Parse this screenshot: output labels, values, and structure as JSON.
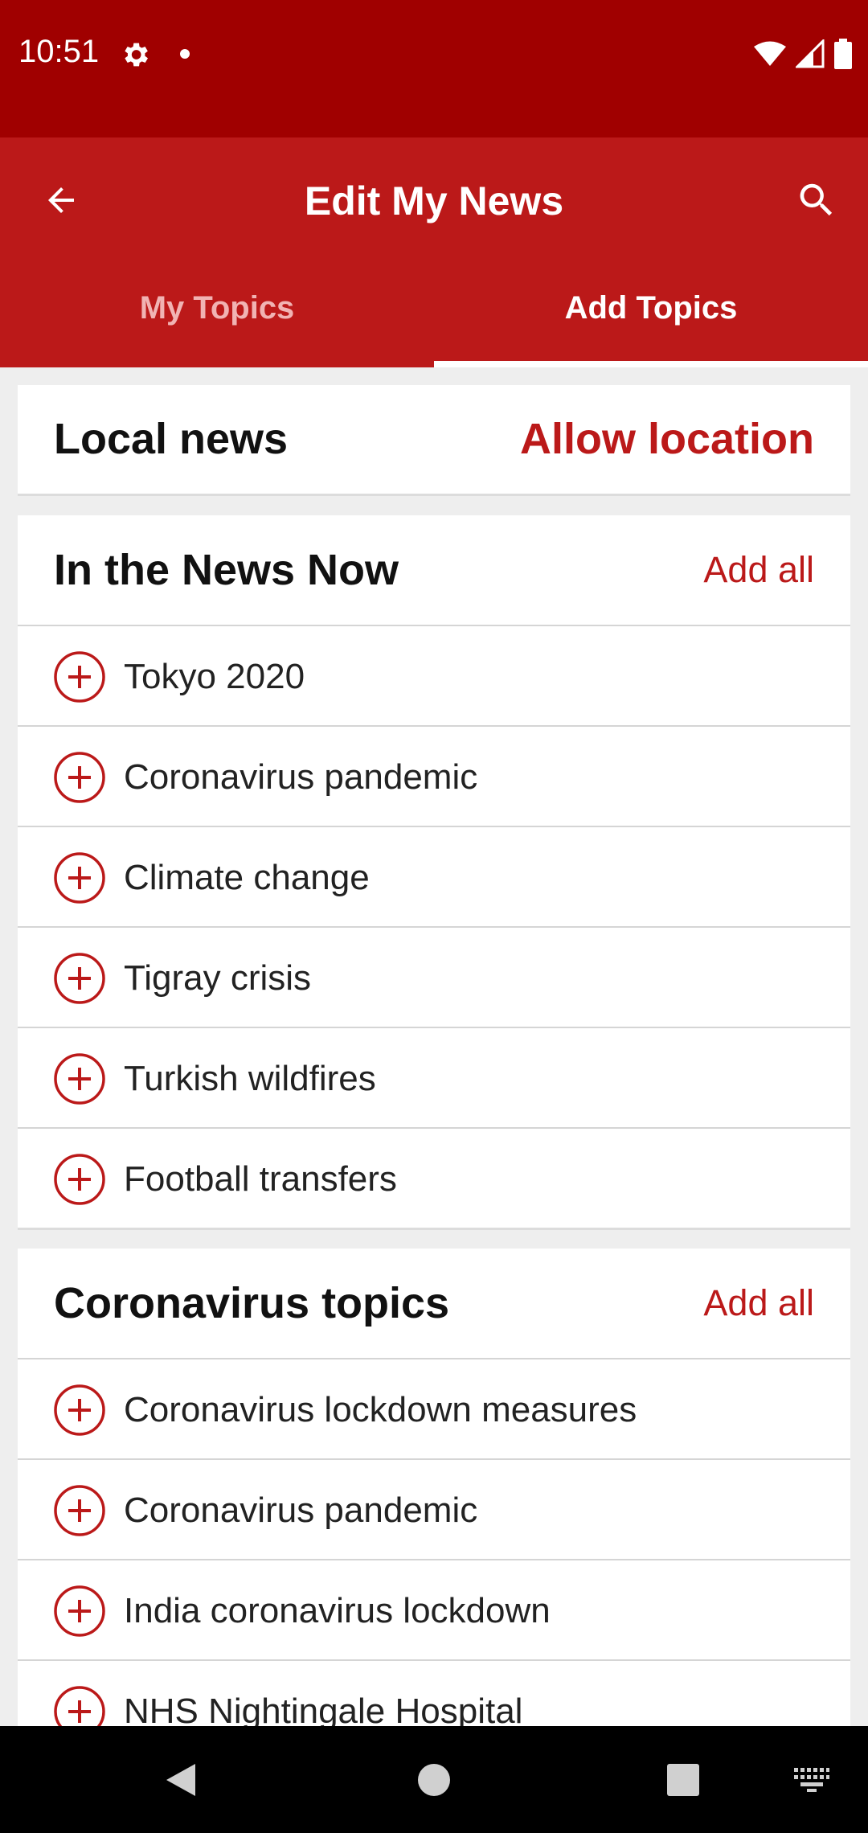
{
  "status_bar": {
    "time": "10:51",
    "icons": [
      "gear-icon",
      "notification-dot-icon",
      "wifi-icon",
      "signal-icon",
      "battery-icon"
    ]
  },
  "app_bar": {
    "title": "Edit My News",
    "back_icon": "arrow-left-icon",
    "search_icon": "search-icon",
    "tabs": [
      {
        "label": "My Topics",
        "selected": false
      },
      {
        "label": "Add Topics",
        "selected": true
      }
    ]
  },
  "local_news": {
    "title": "Local news",
    "action": "Allow location"
  },
  "sections": [
    {
      "title": "In the News Now",
      "action": "Add all",
      "topics": [
        "Tokyo 2020",
        "Coronavirus pandemic",
        "Climate change",
        "Tigray crisis",
        "Turkish wildfires",
        "Football transfers"
      ]
    },
    {
      "title": "Coronavirus topics",
      "action": "Add all",
      "topics": [
        "Coronavirus lockdown measures",
        "Coronavirus pandemic",
        "India coronavirus lockdown",
        "NHS Nightingale Hospital"
      ]
    }
  ],
  "colors": {
    "status_bar": "#a00000",
    "app_bar": "#bb1919",
    "accent": "#bb1919",
    "nav_bar": "#000000"
  },
  "nav_bar": {
    "buttons": [
      "back-triangle-icon",
      "home-circle-icon",
      "recents-square-icon",
      "keyboard-icon"
    ]
  }
}
